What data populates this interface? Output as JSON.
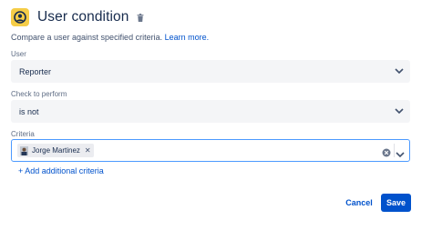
{
  "header": {
    "title": "User condition",
    "icon": "user-circle-icon",
    "delete_icon": "trash-icon",
    "accent": "#f5cd47"
  },
  "description": {
    "text": "Compare a user against specified criteria. ",
    "link": "Learn more."
  },
  "fields": {
    "user": {
      "label": "User",
      "value": "Reporter"
    },
    "check": {
      "label": "Check to perform",
      "value": "is not"
    },
    "criteria": {
      "label": "Criteria",
      "tags": [
        {
          "name": "Jorge Martinez"
        }
      ]
    }
  },
  "add_criteria": "+ Add additional criteria",
  "buttons": {
    "cancel": "Cancel",
    "save": "Save"
  },
  "colors": {
    "primary": "#0052cc",
    "focus_border": "#4c9aff",
    "field_bg": "#f4f5f7"
  }
}
